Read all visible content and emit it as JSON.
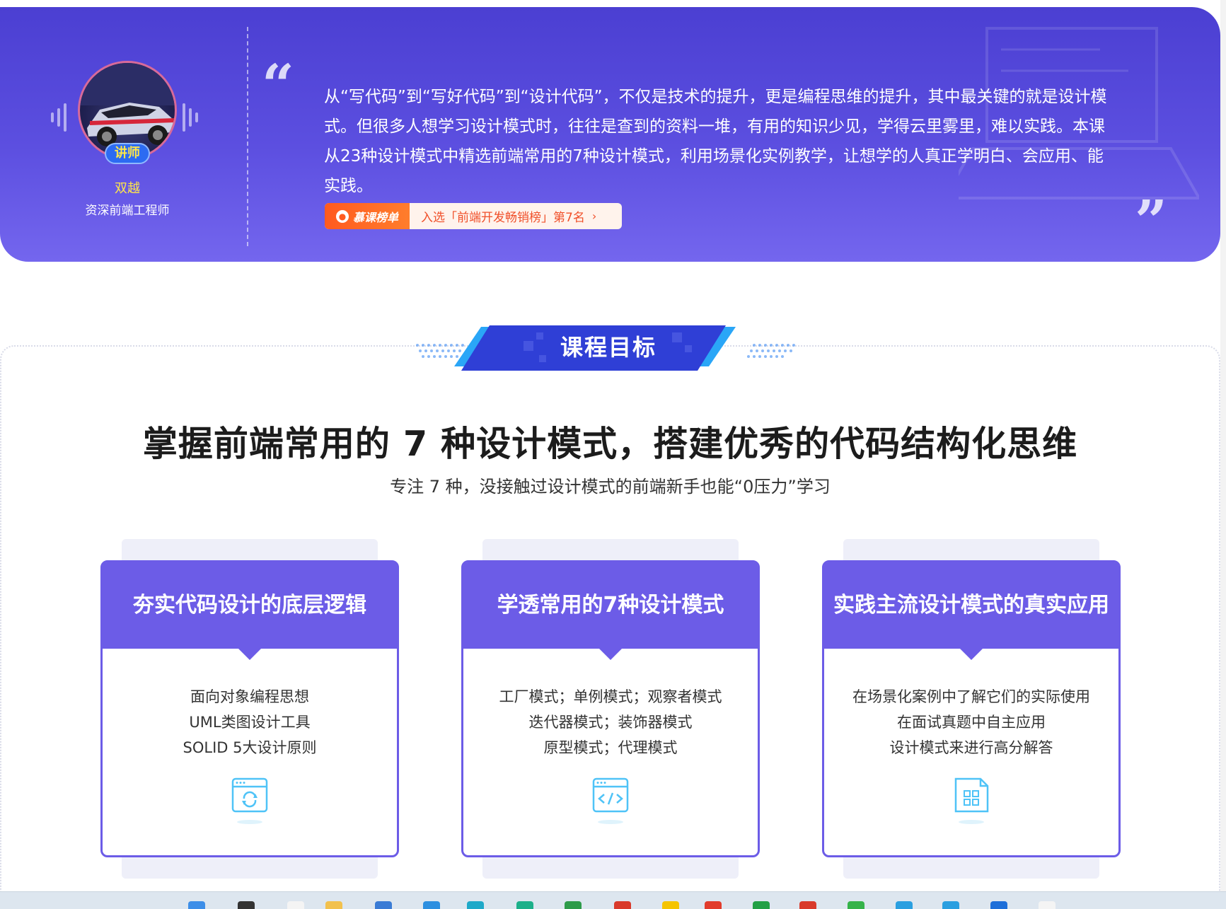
{
  "teacher": {
    "badge": "讲师",
    "name": "双越",
    "title": "资深前端工程师"
  },
  "intro": {
    "quote_open": "“",
    "quote_close": "”",
    "text": "从“写代码”到“写好代码”到“设计代码”，不仅是技术的提升，更是编程思维的提升，其中最关键的就是设计模式。但很多人想学习设计模式时，往往是查到的资料一堆，有用的知识少见，学得云里雾里，难以实践。本课从23种设计模式中精选前端常用的7种设计模式，利用场景化实例教学，让想学的人真正学明白、会应用、能实践。",
    "rank_tag": "慕课榜单",
    "rank_text": "入选「前端开发畅销榜」第7名",
    "rank_arrow": "›"
  },
  "goal": {
    "badge_label": "课程目标",
    "heading": "掌握前端常用的 7 种设计模式，搭建优秀的代码结构化思维",
    "subheading": "专注 7 种，没接触过设计模式的前端新手也能“0压力”学习"
  },
  "cards": [
    {
      "title": "夯实代码设计的底层逻辑",
      "lines": [
        "面向对象编程思想",
        "UML类图设计工具",
        "SOLID 5大设计原则"
      ],
      "icon": "browser-refresh-icon"
    },
    {
      "title": "学透常用的7种设计模式",
      "lines": [
        "工厂模式；单例模式；观察者模式",
        "迭代器模式；装饰器模式",
        "原型模式；代理模式"
      ],
      "icon": "browser-code-icon"
    },
    {
      "title": "实践主流设计模式的真实应用",
      "lines": [
        "在场景化案例中了解它们的实际使用",
        "在面试真题中自主应用",
        "设计模式来进行高分解答"
      ],
      "icon": "document-grid-icon"
    }
  ],
  "colors": {
    "banner_top": "#4b3fd2",
    "banner_bottom": "#7466ee",
    "card_accent": "#6c5ce7",
    "badge_blue": "#2f3fd6",
    "rank_orange": "#ff5a1f",
    "icon_cyan": "#4fc3f7"
  }
}
